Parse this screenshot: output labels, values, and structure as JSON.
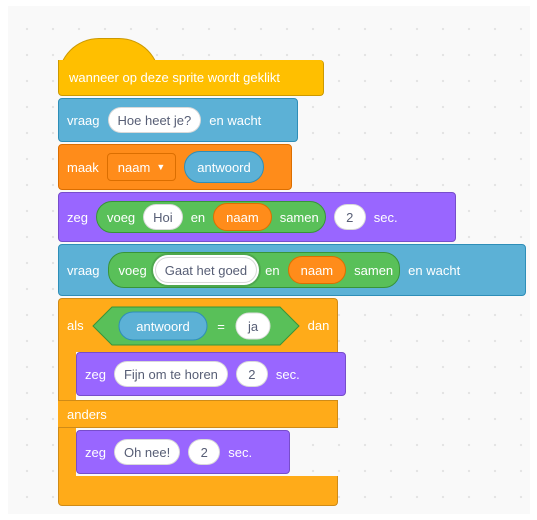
{
  "script": {
    "hat": {
      "label": "wanneer op deze sprite wordt geklikt"
    },
    "ask1": {
      "verb": "vraag",
      "question": "Hoe heet je?",
      "suffix": "en wacht"
    },
    "set": {
      "verb": "maak",
      "variable": "naam",
      "value_reporter": "antwoord"
    },
    "say1": {
      "verb": "zeg",
      "join_label": "voeg",
      "part1": "Hoi",
      "and_label": "en",
      "part2": "naam",
      "join_suffix": "samen",
      "secs": "2",
      "secs_label": "sec."
    },
    "ask2": {
      "verb": "vraag",
      "join_label": "voeg",
      "part1": "Gaat het goed",
      "and_label": "en",
      "part2": "naam",
      "join_suffix": "samen",
      "suffix": "en wacht"
    },
    "ifelse": {
      "if_label": "als",
      "condition": {
        "left": "antwoord",
        "op": "=",
        "right": "ja"
      },
      "then_label": "dan",
      "else_label": "anders"
    },
    "say2": {
      "verb": "zeg",
      "message": "Fijn om te horen",
      "secs": "2",
      "secs_label": "sec."
    },
    "say3": {
      "verb": "zeg",
      "message": "Oh nee!",
      "secs": "2",
      "secs_label": "sec."
    }
  },
  "colors": {
    "events": "#ffbf00",
    "sensing": "#5cb1d6",
    "variables": "#ff8c1a",
    "looks": "#9966ff",
    "operators": "#59c059",
    "control": "#ffab19",
    "canvas": "#f9f9f9"
  }
}
